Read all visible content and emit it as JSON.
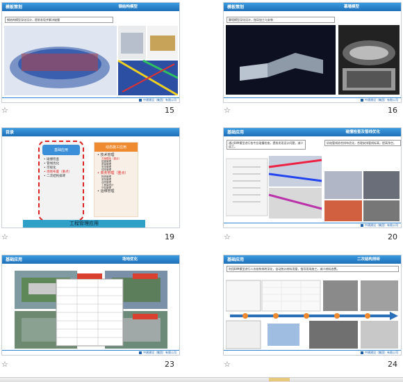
{
  "slides": [
    {
      "number": "15",
      "title": "模板策划",
      "subtitle": "钢结构模型",
      "caption": "钢结构模型深化设计，提前发现并解决碰撞"
    },
    {
      "number": "16",
      "title": "模板策划",
      "subtitle": "幕墙模型",
      "caption": "幕墙模型深化设计，指导加工与安装"
    },
    {
      "number": "19",
      "title": "目录",
      "col1_title": "基础应用",
      "col1_items": [
        "碰撞检查",
        "管线优化",
        "可视化",
        "场地布置（重点）",
        "二次结构排砖"
      ],
      "col2_title": "动态施工应用",
      "col2_sub1": "技术管理",
      "col2_sub1_items": [
        "方案模拟（重点）",
        "进度管理",
        "质量管理",
        "安全管理",
        "成本管理"
      ],
      "col2_sub2": "商务管理（重点）",
      "col2_sub2_items": [
        "物资管理",
        "劳务管理",
        "合同管理",
        "工程量统计",
        "分包管理"
      ],
      "col2_sub3": "运维管理",
      "banner": "工程管理应用"
    },
    {
      "number": "20",
      "title": "基础应用",
      "subtitle": "碰撞检查及管线优化",
      "caption_left": "通过BIM模型进行各专业碰撞检查，提前发现设计问题，减少返工。",
      "caption_right": "机电管线综合排布优化，合理安排管线标高，提高净空。"
    },
    {
      "number": "23",
      "title": "基础应用",
      "subtitle": "场地优化"
    },
    {
      "number": "24",
      "title": "基础应用",
      "subtitle": "二次结构排砖",
      "caption": "利用BIM模型进行二次结构排砖深化，自动统计材料用量，指导现场施工，减少材料浪费。"
    }
  ],
  "colors": {
    "header": "#2a86d4",
    "red": "#d22222",
    "orange": "#f08a30"
  }
}
